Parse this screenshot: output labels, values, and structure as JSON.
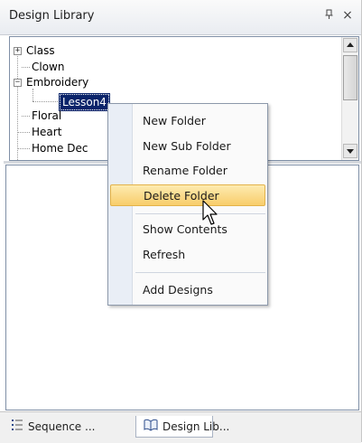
{
  "panel": {
    "title": "Design Library",
    "pin_glyph": "ᵖ",
    "close_glyph": "×"
  },
  "tree": {
    "nodes": [
      {
        "label": "Class",
        "expander": "+"
      },
      {
        "label": "Clown"
      },
      {
        "label": "Embroidery",
        "expander": "−"
      },
      {
        "label": "Lesson4",
        "selected": true
      },
      {
        "label": "Floral"
      },
      {
        "label": "Heart"
      },
      {
        "label": "Home Dec"
      }
    ]
  },
  "context_menu": {
    "items": [
      {
        "label": "New Folder"
      },
      {
        "label": "New Sub Folder"
      },
      {
        "label": "Rename Folder"
      },
      {
        "label": "Delete Folder",
        "highlighted": true
      },
      {
        "label": "Show Contents"
      },
      {
        "label": "Refresh"
      },
      {
        "label": "Add Designs"
      }
    ]
  },
  "tabs": [
    {
      "label": "Sequence ...",
      "icon": "sequence-icon"
    },
    {
      "label": "Design Lib...",
      "icon": "book-icon",
      "active": true
    }
  ],
  "colors": {
    "selection": "#0a246a",
    "menu_highlight": "#f8cd6b",
    "border": "#7f8fa6"
  }
}
